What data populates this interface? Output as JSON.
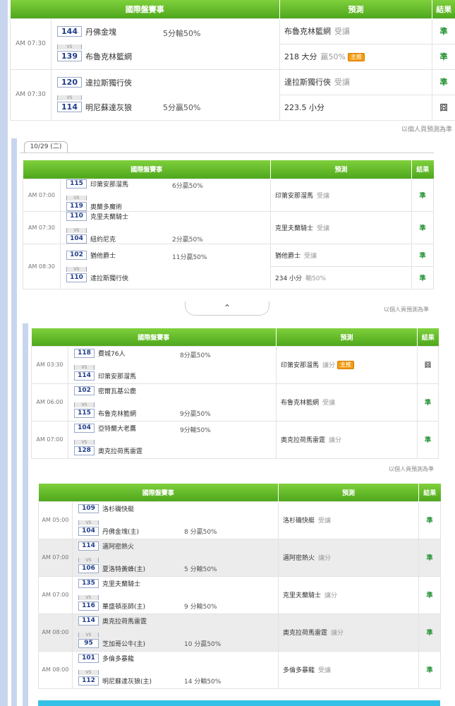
{
  "headers": {
    "match": "國際盤賽事",
    "prediction": "預測",
    "result": "結果"
  },
  "note": "以個人頁預測為準",
  "collapse_icon": "chevron-up-icon",
  "date_tab": "10/29 (二)",
  "section1": {
    "rows": [
      {
        "time": "AM 07:30",
        "home_num": "144",
        "home": "丹佛金塊",
        "away_num": "139",
        "away": "布魯克林籃網",
        "spread": "5分輸50%",
        "preds": [
          {
            "pick": "布魯克林籃網",
            "type": "受讓",
            "badge": "",
            "result": "準"
          },
          {
            "pick": "218 大分",
            "type": "贏50%",
            "badge": "主推",
            "result": "準"
          }
        ]
      },
      {
        "time": "AM 07:30",
        "home_num": "120",
        "home": "達拉斯獨行俠",
        "away_num": "114",
        "away": "明尼蘇達灰狼",
        "spread": "5分贏50%",
        "preds": [
          {
            "pick": "達拉斯獨行俠",
            "type": "受讓",
            "badge": "",
            "result": "準"
          },
          {
            "pick": "223.5 小分",
            "type": "",
            "badge": "",
            "result": "囧"
          }
        ]
      }
    ]
  },
  "section2": {
    "rows": [
      {
        "time": "AM 07:00",
        "home_num": "115",
        "home": "印第安那溜馬",
        "away_num": "119",
        "away": "奧蘭多魔術",
        "spread": "6分贏50%",
        "preds": [
          {
            "pick": "印第安那溜馬",
            "type": "受讓",
            "badge": "",
            "result": "準"
          }
        ]
      },
      {
        "time": "AM 07:30",
        "home_num": "110",
        "home": "克里夫蘭騎士",
        "away_num": "104",
        "away": "紐約尼克",
        "spread": "2分贏50%",
        "preds": [
          {
            "pick": "克里夫蘭騎士",
            "type": "受讓",
            "badge": "",
            "result": "準"
          }
        ]
      },
      {
        "time": "AM 08:30",
        "home_num": "102",
        "home": "猶他爵士",
        "away_num": "110",
        "away": "達拉斯獨行俠",
        "spread": "11分贏50%",
        "preds": [
          {
            "pick": "猶他爵士",
            "type": "受讓",
            "badge": "",
            "result": "準"
          },
          {
            "pick": "234 小分",
            "type": "輸50%",
            "badge": "",
            "result": "準"
          }
        ]
      }
    ]
  },
  "section3": {
    "rows": [
      {
        "time": "AM 03:30",
        "home_num": "118",
        "home": "費城76人",
        "away_num": "114",
        "away": "印第安那溜馬",
        "spread": "8分贏50%",
        "preds": [
          {
            "pick": "印第安那溜馬",
            "type": "讓分",
            "badge": "主推",
            "result": "囧"
          }
        ]
      },
      {
        "time": "AM 06:00",
        "home_num": "102",
        "home": "密爾瓦基公鹿",
        "away_num": "115",
        "away": "布魯克林籃網",
        "spread": "9分贏50%",
        "preds": [
          {
            "pick": "布魯克林籃網",
            "type": "受讓",
            "badge": "",
            "result": "準"
          }
        ]
      },
      {
        "time": "AM 07:00",
        "home_num": "104",
        "home": "亞特蘭大老鷹",
        "away_num": "128",
        "away": "奧克拉荷馬雷霆",
        "spread": "9分輸50%",
        "preds": [
          {
            "pick": "奧克拉荷馬雷霆",
            "type": "讓分",
            "badge": "",
            "result": "準"
          }
        ]
      }
    ]
  },
  "section4": {
    "rows": [
      {
        "time": "AM 05:00",
        "home_num": "109",
        "home": "洛杉磯快艇",
        "away_num": "104",
        "away": "丹佛金塊(主)",
        "spread": "8 分贏50%",
        "preds": [
          {
            "pick": "洛杉磯快艇",
            "type": "受讓",
            "badge": "",
            "result": "準"
          }
        ]
      },
      {
        "time": "AM 07:00",
        "home_num": "114",
        "home": "邁阿密熱火",
        "away_num": "106",
        "away": "夏洛特黃蜂(主)",
        "spread": "5 分輸50%",
        "preds": [
          {
            "pick": "邁阿密熱火",
            "type": "讓分",
            "badge": "",
            "result": "準"
          }
        ]
      },
      {
        "time": "AM 07:00",
        "home_num": "135",
        "home": "克里夫蘭騎士",
        "away_num": "116",
        "away": "華盛頓巫師(主)",
        "spread": "9 分輸50%",
        "preds": [
          {
            "pick": "克里夫蘭騎士",
            "type": "讓分",
            "badge": "",
            "result": "準"
          }
        ]
      },
      {
        "time": "AM 08:00",
        "home_num": "114",
        "home": "奧克拉荷馬雷霆",
        "away_num": "95",
        "away": "芝加哥公牛(主)",
        "spread": "10 分贏50%",
        "preds": [
          {
            "pick": "奧克拉荷馬雷霆",
            "type": "讓分",
            "badge": "",
            "result": "準"
          }
        ]
      },
      {
        "time": "AM 08:00",
        "home_num": "101",
        "home": "多倫多暴龍",
        "away_num": "112",
        "away": "明尼蘇達灰狼(主)",
        "spread": "14 分輸50%",
        "preds": [
          {
            "pick": "多倫多暴龍",
            "type": "受讓",
            "badge": "",
            "result": "準"
          }
        ]
      }
    ]
  }
}
